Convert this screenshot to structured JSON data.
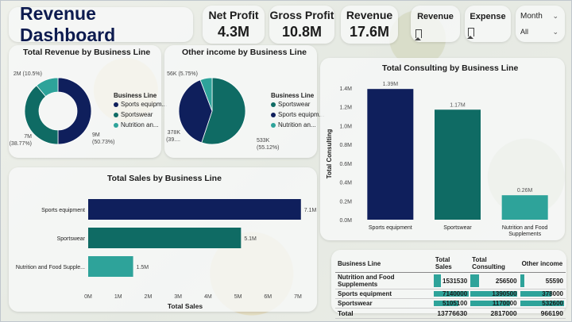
{
  "header": {
    "title": "Revenue Dashboard",
    "kpis": [
      {
        "label": "Net Profit",
        "value": "4.3M"
      },
      {
        "label": "Gross Profit",
        "value": "10.8M"
      },
      {
        "label": "Revenue",
        "value": "17.6M"
      }
    ],
    "bookmarks": [
      {
        "label": "Revenue",
        "icon": "bookmark-icon"
      },
      {
        "label": "Expense",
        "icon": "bookmark-icon"
      }
    ],
    "slicer": {
      "label": "Month",
      "selected": "All"
    }
  },
  "colors": {
    "navy": "#0f1f5c",
    "teal": "#0f6b64",
    "aqua": "#2ea39a"
  },
  "chart_data": [
    {
      "type": "pie",
      "variant": "donut",
      "title": "Total Revenue by Business Line",
      "legend_title": "Business Line",
      "categories": [
        "Sports equipment",
        "Sportswear",
        "Nutrition and Food Supplements"
      ],
      "legend_labels": [
        "Sports equipm...",
        "Sportswear",
        "Nutrition an..."
      ],
      "values": [
        9,
        7,
        2
      ],
      "percent": [
        50.73,
        38.77,
        10.5
      ],
      "labels": [
        [
          "9M",
          "(50.73%)"
        ],
        [
          "7M",
          "(38.77%)"
        ],
        [
          "2M (10.5%)"
        ]
      ]
    },
    {
      "type": "pie",
      "title": "Other income by Business Line",
      "legend_title": "Business Line",
      "categories": [
        "Sportswear",
        "Sports equipment",
        "Nutrition and Food Supplements"
      ],
      "legend_labels": [
        "Sportswear",
        "Sports equipm...",
        "Nutrition an..."
      ],
      "values": [
        533,
        378,
        56
      ],
      "percent": [
        55.12,
        39.13,
        5.75
      ],
      "labels": [
        [
          "533K",
          "(55.12%)"
        ],
        [
          "378K",
          "(39...."
        ],
        [
          "56K (5.75%)"
        ]
      ]
    },
    {
      "type": "bar",
      "orientation": "vertical",
      "title": "Total Consulting by Business Line",
      "ylabel": "Total Consulting",
      "xlabel": "",
      "categories": [
        "Sports equipment",
        "Sportswear",
        "Nutrition and Food Supplements"
      ],
      "category_labels": [
        [
          "Sports equipment"
        ],
        [
          "Sportswear"
        ],
        [
          "Nutrition and Food",
          "Supplements"
        ]
      ],
      "values": [
        1.39,
        1.17,
        0.26
      ],
      "data_labels": [
        "1.39M",
        "1.17M",
        "0.26M"
      ],
      "ylim": [
        0,
        1.4
      ],
      "yticks": [
        "0.0M",
        "0.2M",
        "0.4M",
        "0.6M",
        "0.8M",
        "1.0M",
        "1.2M",
        "1.4M"
      ],
      "colors": [
        "#0f1f5c",
        "#0f6b64",
        "#2ea39a"
      ]
    },
    {
      "type": "bar",
      "orientation": "horizontal",
      "title": "Total Sales by Business Line",
      "xlabel": "Total Sales",
      "ylabel": "",
      "categories": [
        "Sports equipment",
        "Sportswear",
        "Nutrition and Food Supple..."
      ],
      "values": [
        7.1,
        5.1,
        1.5
      ],
      "data_labels": [
        "7.1M",
        "5.1M",
        "1.5M"
      ],
      "xlim": [
        0,
        7
      ],
      "xticks": [
        "0M",
        "1M",
        "2M",
        "3M",
        "4M",
        "5M",
        "6M",
        "7M"
      ],
      "colors": [
        "#0f1f5c",
        "#0f6b64",
        "#2ea39a"
      ]
    },
    {
      "type": "table",
      "columns": [
        "Business Line",
        "Total Sales",
        "Total Consulting",
        "Other income"
      ],
      "rows": [
        [
          "Nutrition and Food Supplements",
          "1531530",
          "256500",
          "55590"
        ],
        [
          "Sports equipment",
          "7140000",
          "1390500",
          "378000"
        ],
        [
          "Sportswear",
          "5105100",
          "1170000",
          "532600"
        ]
      ],
      "bar_fraction": [
        [
          0.21,
          0.18,
          0.1
        ],
        [
          1.0,
          1.0,
          0.71
        ],
        [
          0.71,
          0.84,
          1.0
        ]
      ],
      "total": [
        "Total",
        "13776630",
        "2817000",
        "966190"
      ]
    }
  ]
}
